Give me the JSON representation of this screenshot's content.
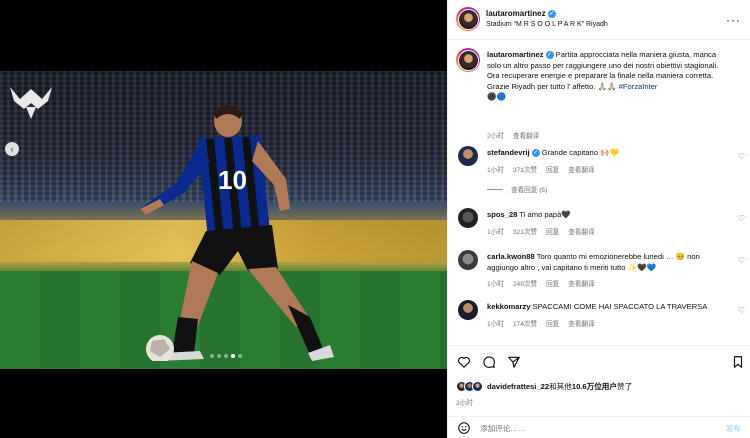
{
  "media": {
    "carousel_index": 4,
    "carousel_total": 5
  },
  "header": {
    "username": "lautaromartinez",
    "location": "Stadium “M R S O O L P A R K” Riyadh",
    "more_icon": "more-horizontal-icon"
  },
  "caption": {
    "username": "lautaromartinez",
    "text": "Partita approcciata nella maniera giusta, manca solo un altro passo per raggiungere uno dei nostri obiettivi stagionali. Ora recuperare energie e preparare la finale nella maniera corretta. Grazie Riyadh per tutto l’ affetto. 🙏🏼🙏🏼",
    "hashtag": "#ForzaInter",
    "emoji_line": "⚫🔵",
    "time": "2小时",
    "translate": "查看翻译"
  },
  "comments": [
    {
      "username": "stefandevrij",
      "verified": true,
      "text": "Grande capitano 🙌🏼💛",
      "time": "1小时",
      "likes": "371次赞",
      "reply": "回复",
      "translate": "查看翻译",
      "view_replies": "查看回复 (5)"
    },
    {
      "username": "spos_28",
      "verified": false,
      "text": "Ti amo papà🖤",
      "time": "1小时",
      "likes": "321次赞",
      "reply": "回复",
      "translate": "查看翻译"
    },
    {
      "username": "carla.kwon88",
      "verified": false,
      "text": "Toro quanto mi emozionerebbe lunedi … 🥺 non aggiungo altro , vai capitano ti meriti tutto ✨🖤💙",
      "time": "1小时",
      "likes": "248次赞",
      "reply": "回复",
      "translate": "查看翻译"
    },
    {
      "username": "kekkomarzy",
      "verified": false,
      "text": "SPACCAMI COME HAI SPACCATO LA TRAVERSA",
      "time": "1小时",
      "likes": "174次赞",
      "reply": "回复",
      "translate": "查看翻译"
    }
  ],
  "actions": {
    "likes_user": "davidefrattesi_22",
    "likes_rest": "和其他",
    "likes_count": "10.6万位用户",
    "likes_suffix": "赞了",
    "post_time": "2小时"
  },
  "add_comment": {
    "placeholder": "添加评论……",
    "post_label": "发布"
  },
  "colors": {
    "verified": "#3897f0",
    "hashtag": "#00376b",
    "muted": "#737373"
  }
}
